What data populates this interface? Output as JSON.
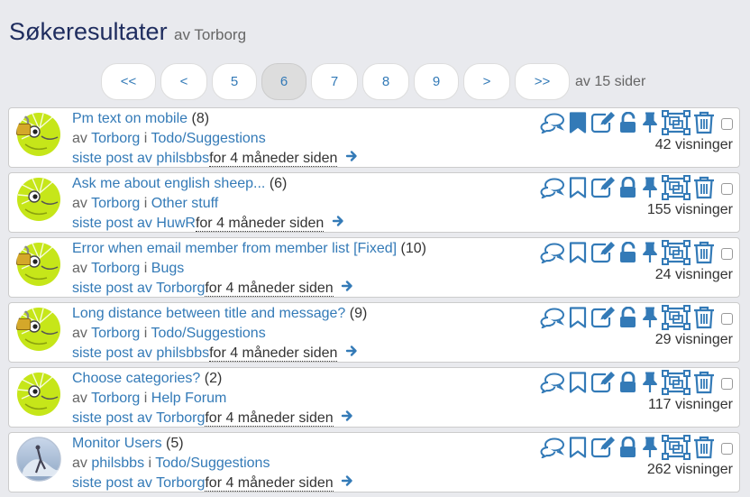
{
  "header": {
    "title": "Søkeresultater",
    "author_line": "av Torborg"
  },
  "pager": {
    "buttons": [
      "<<",
      "<",
      "5",
      "6",
      "7",
      "8",
      "9",
      ">",
      ">>"
    ],
    "active": "6",
    "total": "av 15 sider"
  },
  "colors": {
    "accent": "#337ab7",
    "title": "#1e2c5e",
    "avatar_green": "#c6e619"
  },
  "results": [
    {
      "title": "Pm text on mobile",
      "count": "(8)",
      "by": "av",
      "author": "Torborg",
      "in": "i",
      "category": "Todo/Suggestions",
      "last_prefix": "siste post av",
      "last_user": "philsbbs",
      "last_date": "for 4 måneder siden",
      "views": "42 visninger",
      "avatar": "frog-lock",
      "bookmarked": true,
      "locked": false
    },
    {
      "title": "Ask me about english sheep...",
      "count": "(6)",
      "by": "av",
      "author": "Torborg",
      "in": "i",
      "category": "Other stuff",
      "last_prefix": "siste post av",
      "last_user": "HuwR",
      "last_date": "for 4 måneder siden",
      "views": "155 visninger",
      "avatar": "frog",
      "bookmarked": false,
      "locked": true
    },
    {
      "title": "Error when email member from member list [Fixed]",
      "count": "(10)",
      "by": "av",
      "author": "Torborg",
      "in": "i",
      "category": "Bugs",
      "last_prefix": "siste post av",
      "last_user": "Torborg",
      "last_date": "for 4 måneder siden",
      "views": "24 visninger",
      "avatar": "frog-lock",
      "bookmarked": false,
      "locked": false
    },
    {
      "title": "Long distance between title and message?",
      "count": "(9)",
      "by": "av",
      "author": "Torborg",
      "in": "i",
      "category": "Todo/Suggestions",
      "last_prefix": "siste post av",
      "last_user": "philsbbs",
      "last_date": "for 4 måneder siden",
      "views": "29 visninger",
      "avatar": "frog-lock",
      "bookmarked": false,
      "locked": false
    },
    {
      "title": "Choose categories?",
      "count": "(2)",
      "by": "av",
      "author": "Torborg",
      "in": "i",
      "category": "Help Forum",
      "last_prefix": "siste post av",
      "last_user": "Torborg",
      "last_date": "for 4 måneder siden",
      "views": "117 visninger",
      "avatar": "frog",
      "bookmarked": false,
      "locked": true
    },
    {
      "title": "Monitor Users",
      "count": "(5)",
      "by": "av",
      "author": "philsbbs",
      "in": "i",
      "category": "Todo/Suggestions",
      "last_prefix": "siste post av",
      "last_user": "Torborg",
      "last_date": "for 4 måneder siden",
      "views": "262 visninger",
      "avatar": "photo",
      "bookmarked": false,
      "locked": true
    }
  ]
}
